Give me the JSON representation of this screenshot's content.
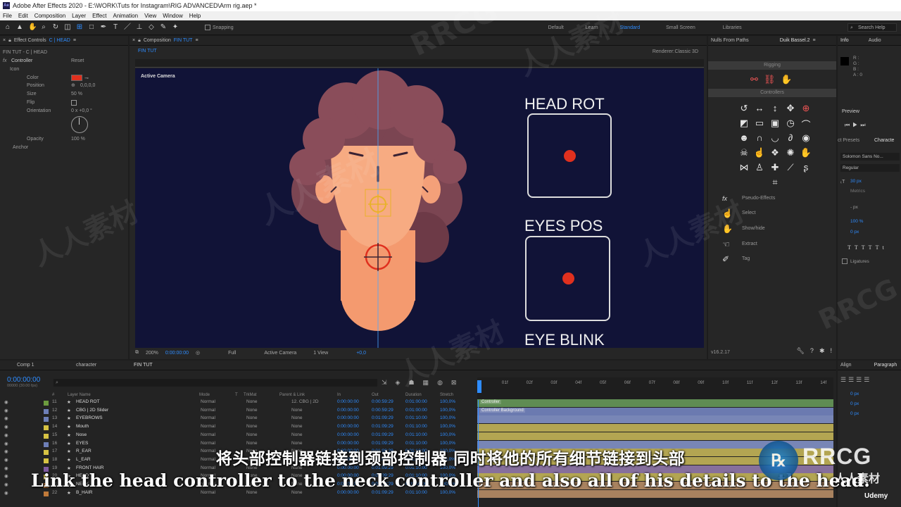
{
  "titlebar": {
    "text": "Adobe After Effects 2020 - E:\\WORK\\Tuts for Instagram\\RIG ADVANCED\\Arm rig.aep *"
  },
  "menu": [
    "File",
    "Edit",
    "Composition",
    "Layer",
    "Effect",
    "Animation",
    "View",
    "Window",
    "Help"
  ],
  "toolbar": {
    "snapping": "Snapping",
    "workspaces": [
      "Default",
      "Learn",
      "Standard",
      "Small Screen",
      "Libraries"
    ],
    "active_workspace": "Standard",
    "search_placeholder": "Search Help"
  },
  "effect_controls": {
    "tab": "Effect Controls",
    "tab_target": "C | HEAD",
    "breadcrumb": "FIN TUT - C | HEAD",
    "effect_name": "Controller",
    "reset": "Reset",
    "icon_label": "Icon",
    "color_label": "Color",
    "color_value": "#e0301e",
    "position_label": "Position",
    "position_value": "0,0,0,0",
    "size_label": "Size",
    "size_value": "50 %",
    "flip_label": "Flip",
    "orientation_label": "Orientation",
    "orientation_value": "0 x +0,0 °",
    "opacity_label": "Opacity",
    "opacity_value": "100 %",
    "anchor_label": "Anchor"
  },
  "composition": {
    "tab": "Composition",
    "tab_name": "FIN TUT",
    "subtab": "FIN TUT",
    "renderer_label": "Renderer:",
    "renderer_value": "Classic 3D",
    "active_camera": "Active Camera",
    "controllers": [
      {
        "label": "HEAD ROT"
      },
      {
        "label": "EYES POS"
      },
      {
        "label": "EYE BLINK"
      }
    ],
    "footer": {
      "zoom": "200%",
      "time": "0:00:00:00",
      "quality": "Full",
      "camera": "Active Camera",
      "views": "1 View",
      "offset": "+0,0"
    }
  },
  "right_panel": {
    "tab_left": "Nulls From Paths",
    "tab_right": "Duik Bassel.2",
    "section_rigging": "Rigging",
    "section_controllers": "Controllers",
    "fx_label": "Pseudo-Effects",
    "actions": [
      "Select",
      "Show/hide",
      "Extract",
      "Tag"
    ],
    "version": "v16.2.17"
  },
  "far_right": {
    "info_tab": "Info",
    "audio_tab": "Audio",
    "rgb": [
      "R :",
      "G :",
      "B :",
      "A : 0"
    ],
    "preview": "Preview",
    "presets_tab": "ct Presets",
    "character_tab": "Characte",
    "font": "Solomon Sans No...",
    "style": "Regular",
    "size": "30 px",
    "metrics": "Metrics",
    "leading": "- px",
    "scale": "100 %",
    "baseline": "0 px",
    "ligatures": "Ligatures",
    "align_tab": "Align",
    "paragraph_tab": "Paragraph",
    "para_values": [
      "0 px",
      "0 px",
      "0 px"
    ]
  },
  "timeline": {
    "tabs": [
      "Comp 1",
      "character",
      "FIN TUT"
    ],
    "active_tab": "FIN TUT",
    "timecode": "0:00:00:00",
    "timecode_sub": "00000 (30.00 fps)",
    "columns": [
      "#",
      "Layer Name",
      "Mode",
      "T",
      "TrkMat",
      "Parent & Link",
      "In",
      "Out",
      "Duration",
      "Stretch"
    ],
    "ruler_ticks": [
      "0f",
      "01f",
      "02f",
      "03f",
      "04f",
      "05f",
      "06f",
      "07f",
      "08f",
      "09f",
      "10f",
      "11f",
      "12f",
      "13f",
      "14f"
    ],
    "layers": [
      {
        "num": "11",
        "name": "HEAD ROT",
        "mode": "Normal",
        "trk": "None",
        "parent": "12. CBG | 2D",
        "in": "0:00:00:00",
        "out": "0:00:59:29",
        "dur": "0:01:00:00",
        "stretch": "100,0%",
        "color": "#6c9b3f",
        "bar": "#5f8c53",
        "barlabel": "Controller"
      },
      {
        "num": "12",
        "name": "CBG | 2D Slider",
        "mode": "Normal",
        "trk": "None",
        "parent": "None",
        "in": "0:00:00:00",
        "out": "0:00:59:29",
        "dur": "0:01:00:00",
        "stretch": "100,0%",
        "color": "#6e7fb8",
        "bar": "#6b7ab0",
        "barlabel": "Controller Background"
      },
      {
        "num": "13",
        "name": "EYEBROWS",
        "mode": "Normal",
        "trk": "None",
        "parent": "None",
        "in": "0:00:00:00",
        "out": "0:01:09:29",
        "dur": "0:01:10:00",
        "stretch": "100,0%",
        "color": "#6e7fb8",
        "bar": "#7886b6",
        "barlabel": ""
      },
      {
        "num": "14",
        "name": "Mouth",
        "mode": "Normal",
        "trk": "None",
        "parent": "None",
        "in": "0:00:00:00",
        "out": "0:01:09:29",
        "dur": "0:01:10:00",
        "stretch": "100,0%",
        "color": "#d6c243",
        "bar": "#b3a552",
        "barlabel": ""
      },
      {
        "num": "15",
        "name": "Nose",
        "mode": "Normal",
        "trk": "None",
        "parent": "None",
        "in": "0:00:00:00",
        "out": "0:01:09:29",
        "dur": "0:01:10:00",
        "stretch": "100,0%",
        "color": "#d6c243",
        "bar": "#b3a552",
        "barlabel": ""
      },
      {
        "num": "16",
        "name": "EYES",
        "mode": "Normal",
        "trk": "None",
        "parent": "None",
        "in": "0:00:00:00",
        "out": "0:01:09:29",
        "dur": "0:01:10:00",
        "stretch": "100,0%",
        "color": "#6e7fb8",
        "bar": "#7886b6",
        "barlabel": ""
      },
      {
        "num": "17",
        "name": "R_EAR",
        "mode": "Normal",
        "trk": "None",
        "parent": "None",
        "in": "0:00:00:00",
        "out": "0:01:09:29",
        "dur": "0:01:10:00",
        "stretch": "100,0%",
        "color": "#d6c243",
        "bar": "#b3a552",
        "barlabel": ""
      },
      {
        "num": "18",
        "name": "L_EAR",
        "mode": "Normal",
        "trk": "None",
        "parent": "None",
        "in": "0:00:00:00",
        "out": "0:01:09:29",
        "dur": "0:01:10:00",
        "stretch": "100,0%",
        "color": "#d6c243",
        "bar": "#b3a552",
        "barlabel": ""
      },
      {
        "num": "19",
        "name": "FRONT HAIR",
        "mode": "Normal",
        "trk": "None",
        "parent": "None",
        "in": "0:00:00:00",
        "out": "0:01:09:29",
        "dur": "0:01:10:00",
        "stretch": "100,0%",
        "color": "#7e5aa0",
        "bar": "#866f9c",
        "barlabel": ""
      },
      {
        "num": "20",
        "name": "HEAD",
        "mode": "Normal",
        "trk": "None",
        "parent": "None",
        "in": "0:00:00:00",
        "out": "0:01:09:29",
        "dur": "0:01:10:00",
        "stretch": "100,0%",
        "color": "#d6c243",
        "bar": "#b3a552",
        "barlabel": ""
      },
      {
        "num": "21",
        "name": "NECK",
        "mode": "Normal",
        "trk": "None",
        "parent": "None",
        "in": "0:00:00:00",
        "out": "0:01:09:29",
        "dur": "0:01:10:00",
        "stretch": "100,0%",
        "color": "#c07a3a",
        "bar": "#a8825f",
        "barlabel": ""
      },
      {
        "num": "22",
        "name": "B_HAIR",
        "mode": "Normal",
        "trk": "None",
        "parent": "None",
        "in": "0:00:00:00",
        "out": "0:01:09:29",
        "dur": "0:01:10:00",
        "stretch": "100,0%",
        "color": "#c07a3a",
        "bar": "#a8825f",
        "barlabel": ""
      }
    ]
  },
  "subtitles": {
    "chinese": "将头部控制器链接到颈部控制器 同时将他的所有细节链接到头部",
    "english": "Link the head controller to the neck controller and also all of his details to the head."
  },
  "watermarks": {
    "rrcg": "RRCG",
    "cn": "人人素材",
    "brand_cn": "人人素材",
    "brand": "RRCG",
    "udemy": "Udemy"
  },
  "colors": {
    "accent": "#2e8cff",
    "viewer_bg": "#111337",
    "skin": "#f4a079",
    "hair": "#8a4d5a",
    "controller_red": "#e0301e"
  }
}
